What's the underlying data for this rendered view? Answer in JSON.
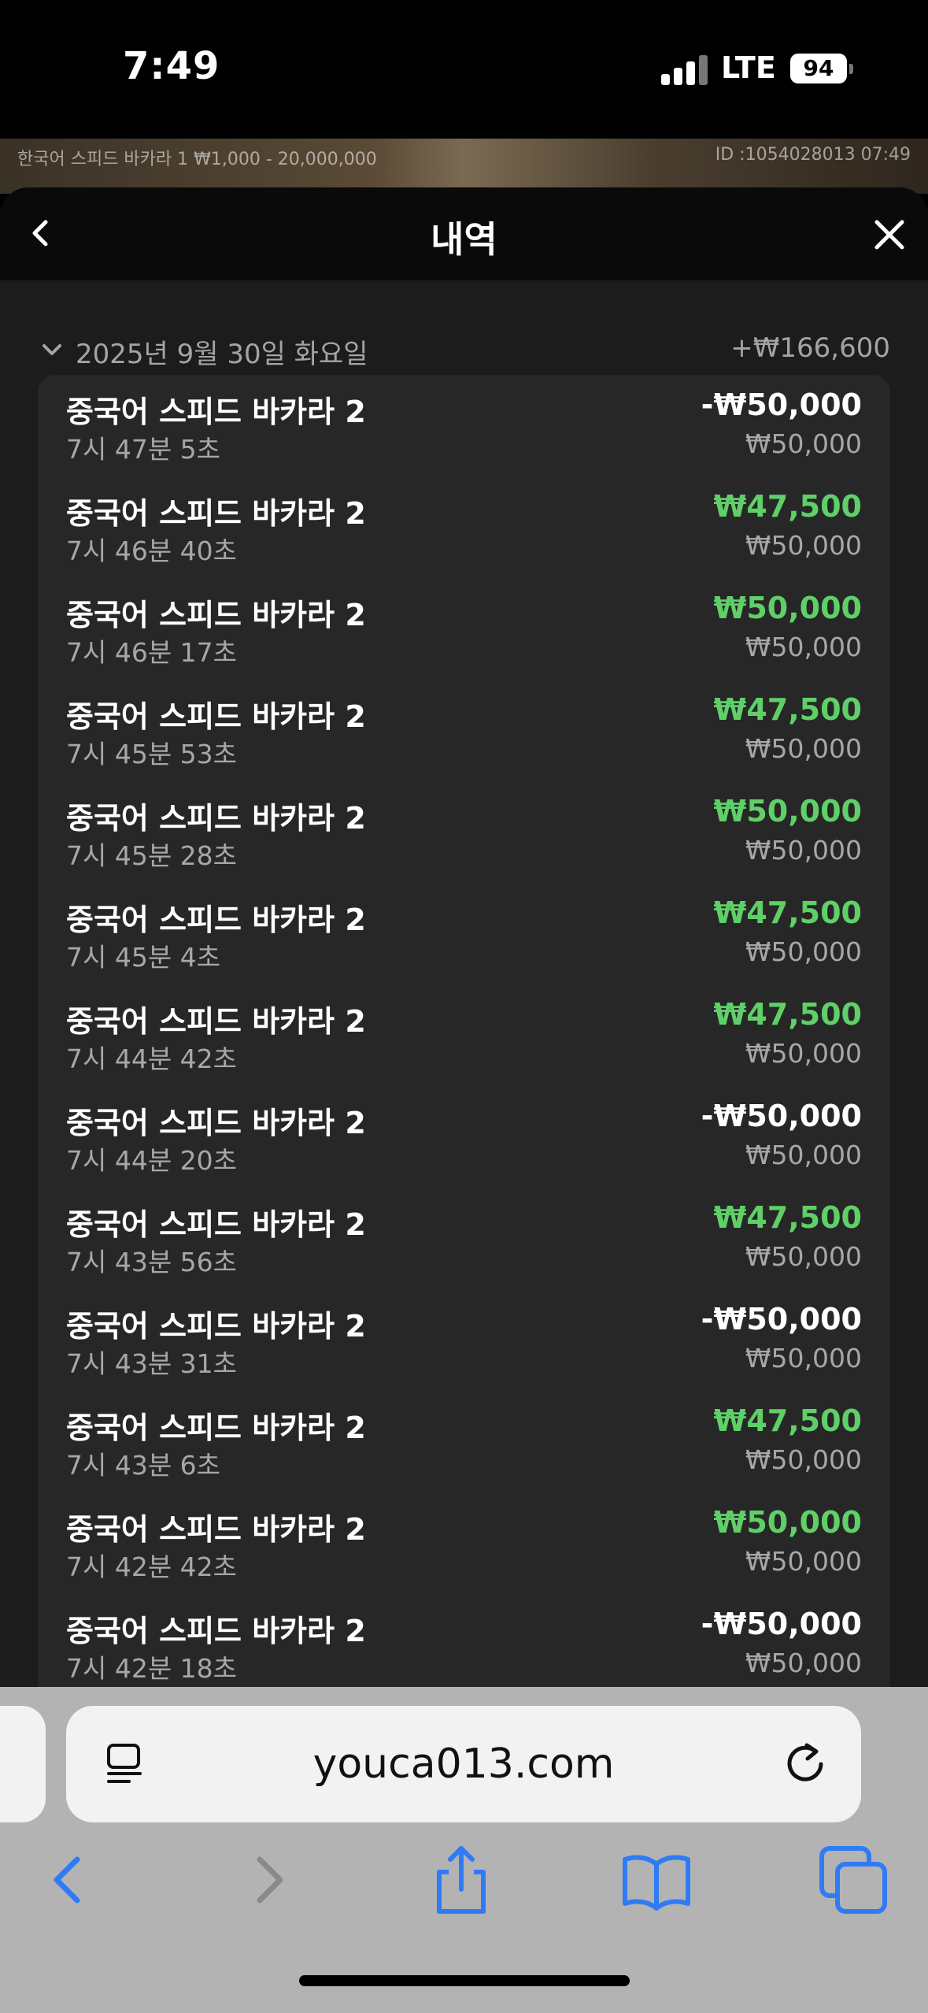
{
  "status_bar": {
    "time": "7:49",
    "network": "LTE",
    "battery": "94"
  },
  "game_strip": {
    "info": "한국어 스피드 바카라 1 ₩1,000 - 20,000,000",
    "id": "ID :1054028013 07:49"
  },
  "modal": {
    "title": "내역",
    "day": {
      "date": "2025년 9월 30일 화요일",
      "total": "+₩166,600"
    },
    "transactions": [
      {
        "name": "중국어 스피드 바카라 2",
        "time": "7시 47분 5초",
        "amount": "-₩50,000",
        "bet": "₩50,000",
        "win": false
      },
      {
        "name": "중국어 스피드 바카라 2",
        "time": "7시 46분 40초",
        "amount": "₩47,500",
        "bet": "₩50,000",
        "win": true
      },
      {
        "name": "중국어 스피드 바카라 2",
        "time": "7시 46분 17초",
        "amount": "₩50,000",
        "bet": "₩50,000",
        "win": true
      },
      {
        "name": "중국어 스피드 바카라 2",
        "time": "7시 45분 53초",
        "amount": "₩47,500",
        "bet": "₩50,000",
        "win": true
      },
      {
        "name": "중국어 스피드 바카라 2",
        "time": "7시 45분 28초",
        "amount": "₩50,000",
        "bet": "₩50,000",
        "win": true
      },
      {
        "name": "중국어 스피드 바카라 2",
        "time": "7시 45분 4초",
        "amount": "₩47,500",
        "bet": "₩50,000",
        "win": true
      },
      {
        "name": "중국어 스피드 바카라 2",
        "time": "7시 44분 42초",
        "amount": "₩47,500",
        "bet": "₩50,000",
        "win": true
      },
      {
        "name": "중국어 스피드 바카라 2",
        "time": "7시 44분 20초",
        "amount": "-₩50,000",
        "bet": "₩50,000",
        "win": false
      },
      {
        "name": "중국어 스피드 바카라 2",
        "time": "7시 43분 56초",
        "amount": "₩47,500",
        "bet": "₩50,000",
        "win": true
      },
      {
        "name": "중국어 스피드 바카라 2",
        "time": "7시 43분 31초",
        "amount": "-₩50,000",
        "bet": "₩50,000",
        "win": false
      },
      {
        "name": "중국어 스피드 바카라 2",
        "time": "7시 43분 6초",
        "amount": "₩47,500",
        "bet": "₩50,000",
        "win": true
      },
      {
        "name": "중국어 스피드 바카라 2",
        "time": "7시 42분 42초",
        "amount": "₩50,000",
        "bet": "₩50,000",
        "win": true
      },
      {
        "name": "중국어 스피드 바카라 2",
        "time": "7시 42분 18초",
        "amount": "-₩50,000",
        "bet": "₩50,000",
        "win": false
      }
    ]
  },
  "browser": {
    "url": "youca013.com"
  },
  "colors": {
    "win": "#5fd068",
    "loss": "#ffffff",
    "accent": "#2f7bf5"
  },
  "icons": {
    "back": "chevron-left-icon",
    "close": "close-icon",
    "collapse": "chevron-down-icon",
    "reader": "reader-icon",
    "reload": "reload-icon",
    "nav_back": "nav-back-icon",
    "nav_forward": "nav-forward-icon",
    "share": "share-icon",
    "bookmarks": "bookmarks-icon",
    "tabs": "tabs-icon"
  }
}
